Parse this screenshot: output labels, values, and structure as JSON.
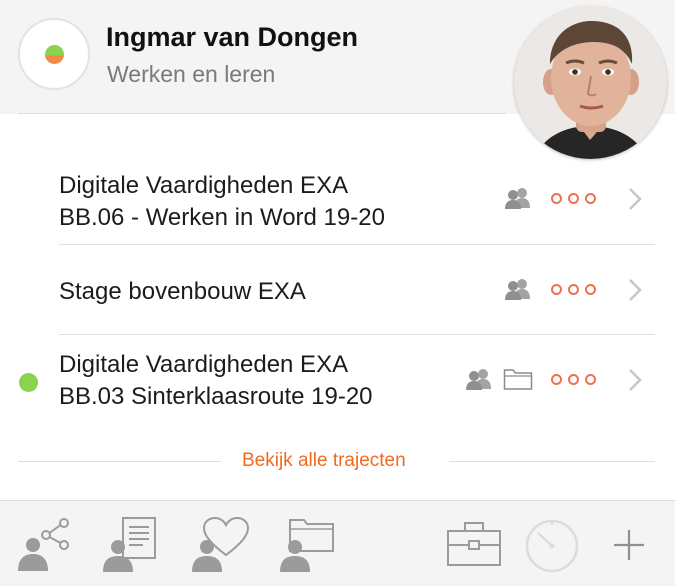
{
  "header": {
    "name": "Ingmar van Dongen",
    "subtitle": "Werken en leren",
    "status": "online-partial"
  },
  "trajects": [
    {
      "line1": "Digitale Vaardigheden EXA",
      "line2": "BB.06 - Werken in Word 19-20",
      "active": false,
      "icons": [
        "group-icon",
        "more-dots-icon",
        "chevron-right-icon"
      ]
    },
    {
      "line1": "Stage bovenbouw EXA",
      "line2": "",
      "active": false,
      "icons": [
        "group-icon",
        "more-dots-icon",
        "chevron-right-icon"
      ]
    },
    {
      "line1": "Digitale Vaardigheden EXA",
      "line2": "BB.03 Sinterklaasroute 19-20",
      "active": true,
      "icons": [
        "group-icon",
        "folder-icon",
        "more-dots-icon",
        "chevron-right-icon"
      ]
    }
  ],
  "more_link": "Bekijk alle trajecten",
  "toolbar": {
    "items": [
      "share-person-icon",
      "document-person-icon",
      "heart-person-icon",
      "folder-person-icon",
      "briefcase-icon",
      "timer-icon",
      "plus-icon"
    ]
  },
  "colors": {
    "accent": "#f06a1f",
    "status_green": "#8bd24f",
    "dots_orange": "#ef7152",
    "icon_gray": "#9a9a9a"
  }
}
